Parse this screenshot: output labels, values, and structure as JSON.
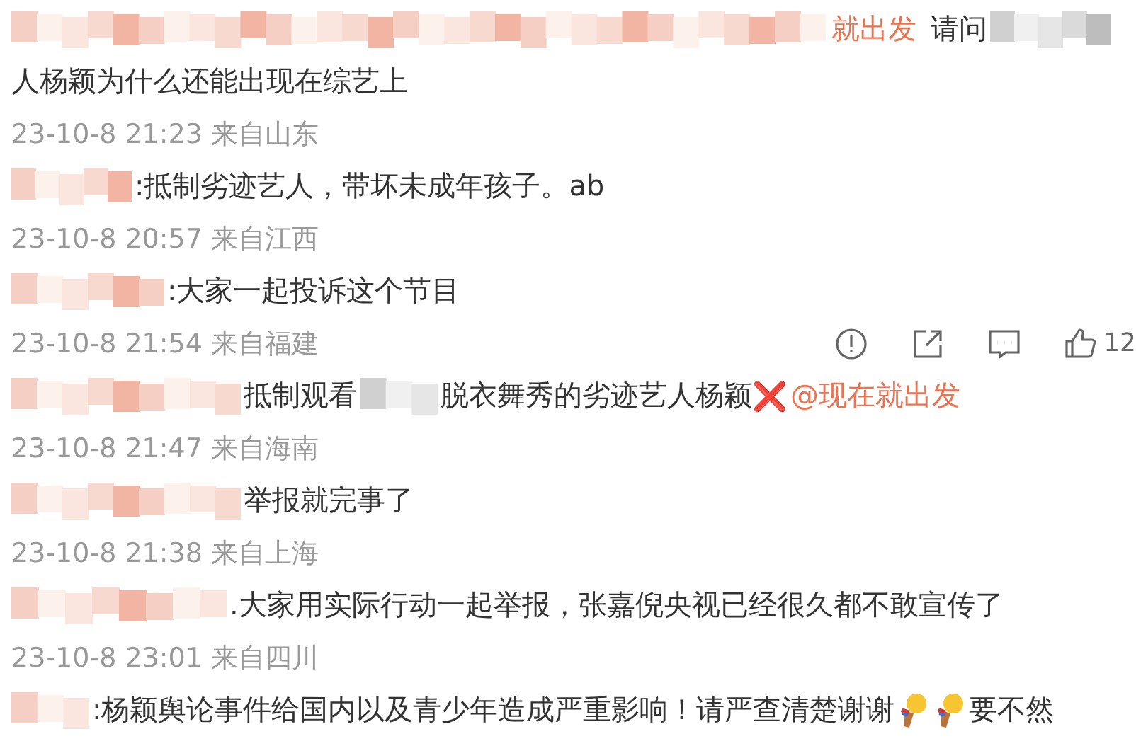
{
  "comments": [
    {
      "lines": [
        [
          {
            "kind": "redaction_xl"
          },
          {
            "kind": "mention",
            "text": "就出发"
          },
          {
            "kind": "text",
            "text": "请问"
          },
          {
            "kind": "redaction_s"
          }
        ],
        [
          {
            "kind": "text",
            "text": "人杨颖为什么还能出现在综艺上"
          }
        ]
      ],
      "time": "23-10-8 21:23",
      "location": "来自山东"
    },
    {
      "lines": [
        [
          {
            "kind": "redaction_s"
          },
          {
            "kind": "text",
            "text": ":抵制劣迹艺人，带坏未成年孩子。ab"
          }
        ]
      ],
      "time": "23-10-8 20:57",
      "location": "来自江西"
    },
    {
      "lines": [
        [
          {
            "kind": "redaction_m"
          },
          {
            "kind": "text",
            "text": ":大家一起投诉这个节目"
          }
        ]
      ],
      "time": "23-10-8 21:54",
      "location": "来自福建",
      "actions": [
        {
          "kind": "report"
        },
        {
          "kind": "share"
        },
        {
          "kind": "comment"
        },
        {
          "kind": "like",
          "count": "12"
        }
      ]
    },
    {
      "lines": [
        [
          {
            "kind": "redaction_l"
          },
          {
            "kind": "text",
            "text": "抵制观看"
          },
          {
            "kind": "redaction_xs"
          },
          {
            "kind": "text",
            "text": "脱衣舞秀的劣迹艺人杨颖"
          },
          {
            "kind": "cross",
            "text": "❌"
          },
          {
            "kind": "mention",
            "text": "@现在就出发"
          }
        ]
      ],
      "time": "23-10-8 21:47",
      "location": "来自海南"
    },
    {
      "lines": [
        [
          {
            "kind": "redaction_l"
          },
          {
            "kind": "text",
            "text": "举报就完事了"
          }
        ]
      ],
      "time": "23-10-8 21:38",
      "location": "来自上海"
    },
    {
      "lines": [
        [
          {
            "kind": "redaction_ml"
          },
          {
            "kind": "text",
            "text": ".大家用实际行动一起举报，张嘉倪央视已经很久都不敢宣传了"
          }
        ]
      ],
      "time": "23-10-8 23:01",
      "location": "来自四川"
    },
    {
      "lines": [
        [
          {
            "kind": "redaction_xs"
          },
          {
            "kind": "text",
            "text": ":杨颖舆论事件给国内以及青少年造成严重影响！请严查清楚谢谢"
          },
          {
            "kind": "bulb"
          },
          {
            "kind": "bulb"
          },
          {
            "kind": "text",
            "text": "要不然"
          }
        ]
      ]
    }
  ]
}
